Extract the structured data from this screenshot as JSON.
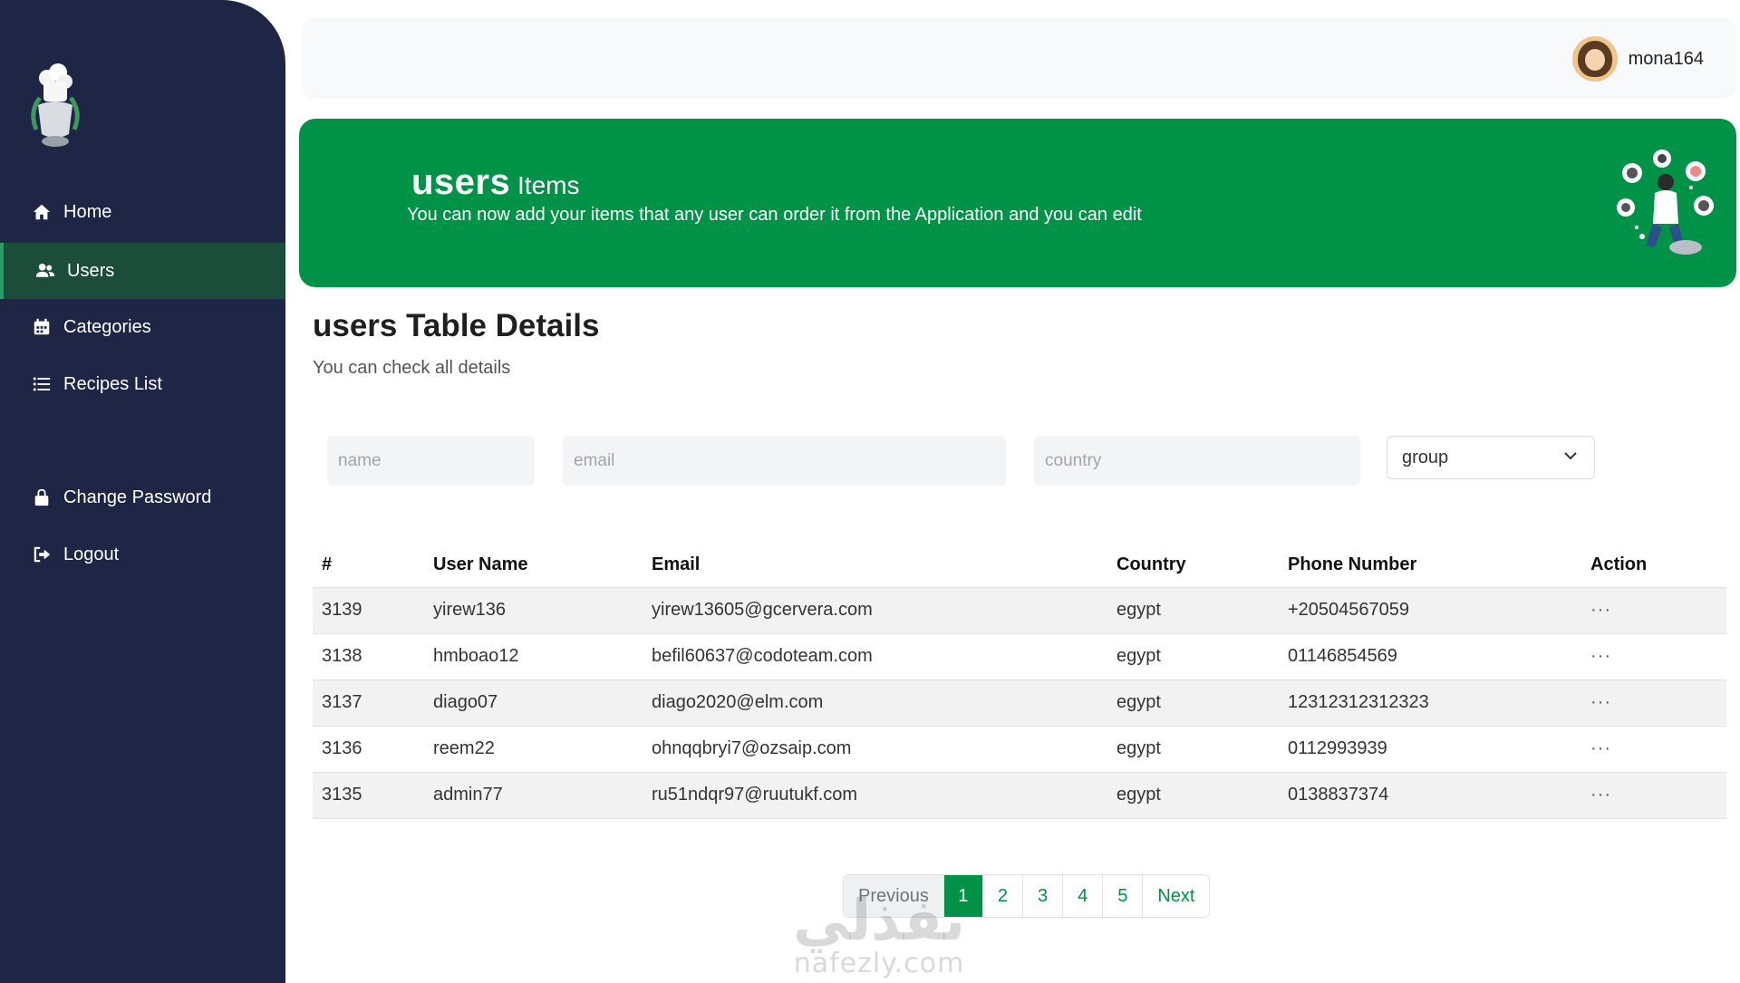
{
  "sidebar": {
    "items": [
      {
        "label": "Home",
        "icon": "home-icon"
      },
      {
        "label": "Users",
        "icon": "users-icon",
        "active": true
      },
      {
        "label": "Categories",
        "icon": "calendar-icon"
      },
      {
        "label": "Recipes List",
        "icon": "list-icon"
      }
    ],
    "bottom_items": [
      {
        "label": "Change Password",
        "icon": "lock-icon"
      },
      {
        "label": "Logout",
        "icon": "logout-icon"
      }
    ]
  },
  "topbar": {
    "username": "mona164"
  },
  "banner": {
    "title_bold": "users",
    "title_rest": " Items",
    "subtitle": "You can now add your items that any user can order it from the Application and you can edit"
  },
  "section": {
    "title": "users Table Details",
    "subtitle": "You can check all details"
  },
  "filters": {
    "name_placeholder": "name",
    "email_placeholder": "email",
    "country_placeholder": "country",
    "group_label": "group"
  },
  "table": {
    "headers": [
      "#",
      "User Name",
      "Email",
      "Country",
      "Phone Number",
      "Action"
    ],
    "rows": [
      {
        "id": "3139",
        "user": "yirew136",
        "email": "yirew13605@gcervera.com",
        "country": "egypt",
        "phone": "+20504567059",
        "action": "···"
      },
      {
        "id": "3138",
        "user": "hmboao12",
        "email": "befil60637@codoteam.com",
        "country": "egypt",
        "phone": "01146854569",
        "action": "···"
      },
      {
        "id": "3137",
        "user": "diago07",
        "email": "diago2020@elm.com",
        "country": "egypt",
        "phone": "12312312312323",
        "action": "···"
      },
      {
        "id": "3136",
        "user": "reem22",
        "email": "ohnqqbryi7@ozsaip.com",
        "country": "egypt",
        "phone": "0112993939",
        "action": "···"
      },
      {
        "id": "3135",
        "user": "admin77",
        "email": "ru51ndqr97@ruutukf.com",
        "country": "egypt",
        "phone": "0138837374",
        "action": "···"
      }
    ]
  },
  "pagination": {
    "previous": "Previous",
    "pages": [
      "1",
      "2",
      "3",
      "4",
      "5"
    ],
    "current": "1",
    "next": "Next"
  },
  "watermark": {
    "arabic": "نفذلي",
    "latin": "nafezly.com"
  },
  "colors": {
    "sidebar": "#1f2544",
    "accent": "#009247",
    "active_item": "#1c4d3b"
  }
}
